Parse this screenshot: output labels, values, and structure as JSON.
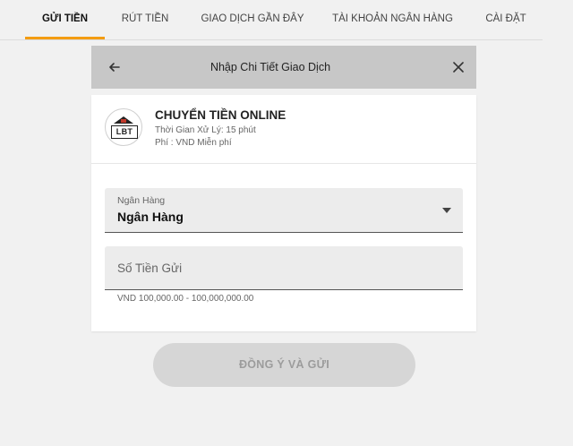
{
  "tabs": [
    {
      "label": "GỬI TIỀN",
      "active": true
    },
    {
      "label": "RÚT TIỀN",
      "active": false
    },
    {
      "label": "GIAO DỊCH GẦN ĐÂY",
      "active": false
    },
    {
      "label": "TÀI KHOẢN NGÂN HÀNG",
      "active": false
    },
    {
      "label": "CÀI ĐẶT",
      "active": false
    }
  ],
  "dialog": {
    "title": "Nhập Chi Tiết Giao Dịch",
    "back_icon": "arrow-left-icon",
    "close_icon": "close-icon"
  },
  "method": {
    "logo_text": "LBT",
    "name": "CHUYỂN TIỀN ONLINE",
    "processing_time": "Thời Gian Xử Lý: 15 phút",
    "fee": "Phí : VND Miễn phí"
  },
  "bank_select": {
    "label": "Ngân Hàng",
    "value": "Ngân Hàng"
  },
  "amount": {
    "placeholder": "Số Tiền Gửi",
    "value": "",
    "hint": "VND 100,000.00 - 100,000,000.00"
  },
  "submit": {
    "label": "ĐỒNG Ý VÀ GỬI",
    "enabled": false
  },
  "colors": {
    "accent": "#f39c12",
    "header_bg": "#c7c7c7",
    "page_bg": "#f1f1f1",
    "button_disabled_bg": "#d6d6d6"
  }
}
